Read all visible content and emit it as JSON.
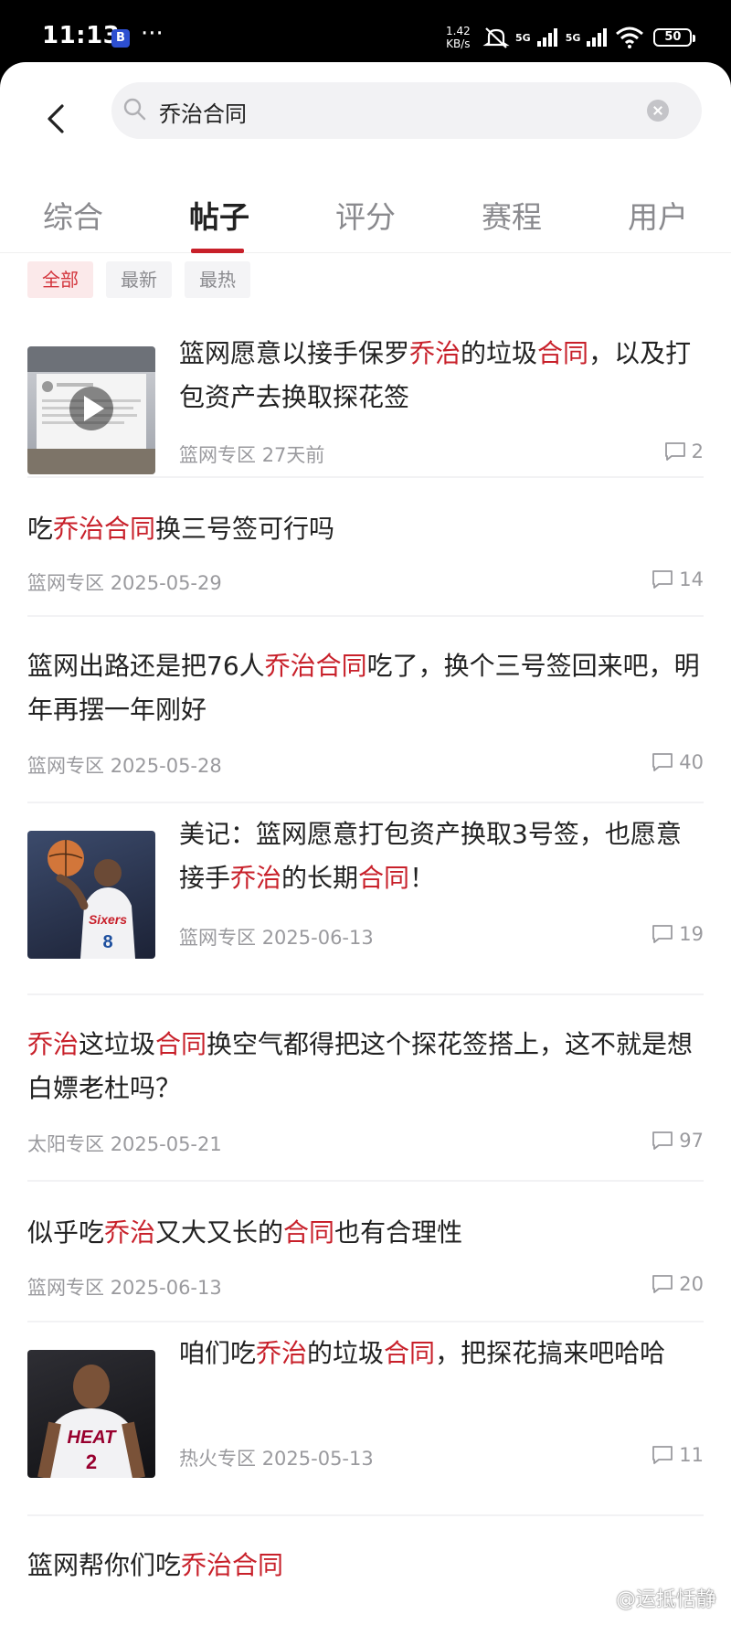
{
  "status_bar": {
    "time": "11:13",
    "app_badge": "B",
    "dots": "···",
    "speed_value": "1.42",
    "speed_unit": "KB/s",
    "net1": "5G",
    "net2": "5G",
    "battery": "50"
  },
  "search": {
    "query": "乔治合同"
  },
  "tabs": [
    {
      "label": "综合",
      "active": false
    },
    {
      "label": "帖子",
      "active": true
    },
    {
      "label": "评分",
      "active": false
    },
    {
      "label": "赛程",
      "active": false
    },
    {
      "label": "用户",
      "active": false
    }
  ],
  "filters": [
    {
      "label": "全部",
      "active": true
    },
    {
      "label": "最新",
      "active": false
    },
    {
      "label": "最热",
      "active": false
    }
  ],
  "posts": [
    {
      "title_parts": [
        "篮网愿意以接手保罗",
        "乔治",
        "的垃圾",
        "合同",
        "，以及打包资产去换取探花签"
      ],
      "section": "篮网专区",
      "date": "27天前",
      "comments": "2",
      "thumb": "video"
    },
    {
      "title_parts": [
        "吃",
        "乔治合同",
        "换三号签可行吗"
      ],
      "section": "篮网专区",
      "date": "2025-05-29",
      "comments": "14"
    },
    {
      "title_parts": [
        "篮网出路还是把76人",
        "乔治合同",
        "吃了，换个三号签回来吧，明年再摆一年刚好"
      ],
      "section": "篮网专区",
      "date": "2025-05-28",
      "comments": "40"
    },
    {
      "title_parts": [
        "美记：篮网愿意打包资产换取3号签，也愿意接手",
        "乔治",
        "的长期",
        "合同",
        "！"
      ],
      "section": "篮网专区",
      "date": "2025-06-13",
      "comments": "19",
      "thumb": "sixers",
      "jersey_text": "Sixers",
      "jersey_number": "8"
    },
    {
      "title_parts": [
        "",
        "乔治",
        "这垃圾",
        "合同",
        "换空气都得把这个探花签搭上，这不就是想白嫖老杜吗？"
      ],
      "section": "太阳专区",
      "date": "2025-05-21",
      "comments": "97"
    },
    {
      "title_parts": [
        "似乎吃",
        "乔治",
        "又大又长的",
        "合同",
        "也有合理性"
      ],
      "section": "篮网专区",
      "date": "2025-06-13",
      "comments": "20"
    },
    {
      "title_parts": [
        "咱们吃",
        "乔治",
        "的垃圾",
        "合同",
        "，把探花搞来吧哈哈"
      ],
      "section": "热火专区",
      "date": "2025-05-13",
      "comments": "11",
      "thumb": "heat",
      "jersey_text": "HEAT",
      "jersey_number": "2"
    },
    {
      "title_parts": [
        "篮网帮你们吃",
        "乔治合同"
      ]
    }
  ],
  "watermark": "@运抵恬静"
}
